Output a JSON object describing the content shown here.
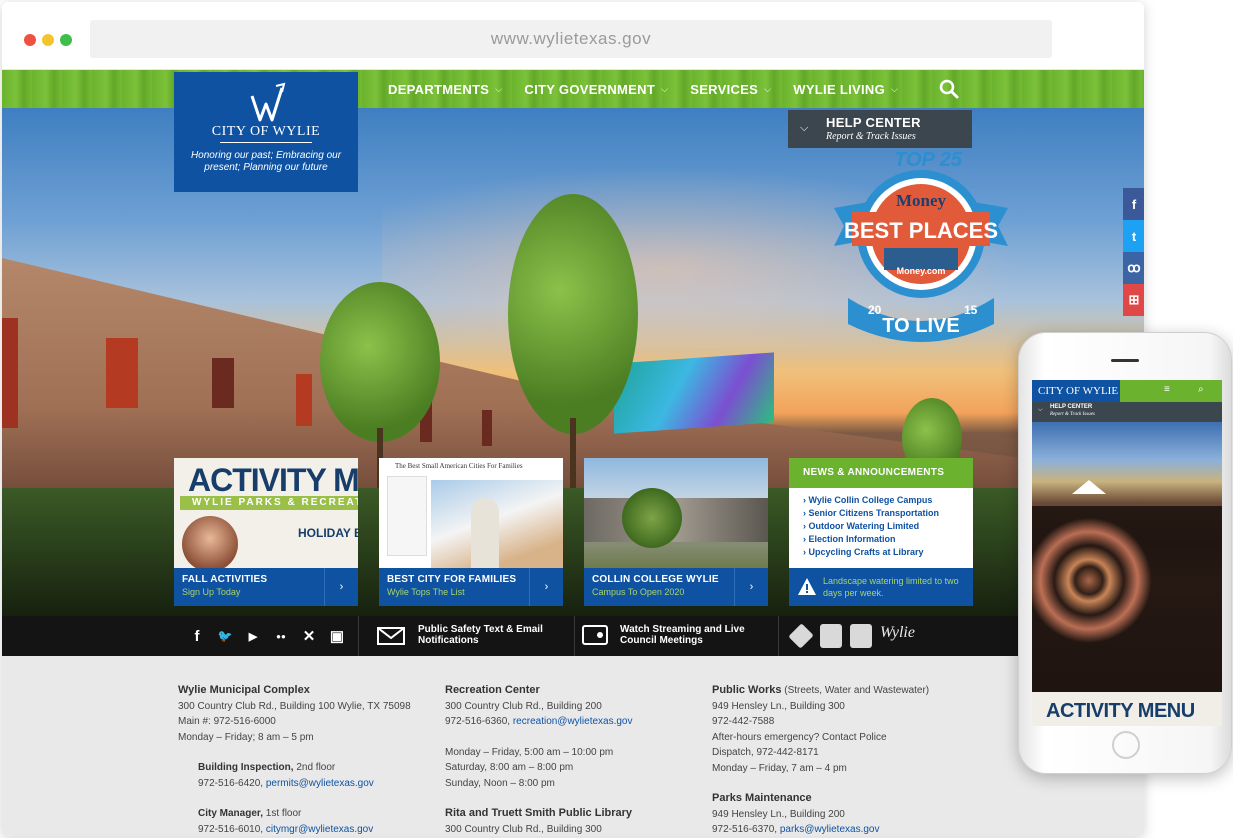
{
  "browser": {
    "url": "www.wylietexas.gov"
  },
  "nav": {
    "items": [
      {
        "label": "DEPARTMENTS"
      },
      {
        "label": "CITY GOVERNMENT"
      },
      {
        "label": "SERVICES"
      },
      {
        "label": "WYLIE LIVING"
      }
    ]
  },
  "logo": {
    "name": "CITY OF WYLIE",
    "tagline": "Honoring our past; Embracing our present; Planning our future"
  },
  "help_center": {
    "title": "HELP CENTER",
    "subtitle": "Report & Track Issues"
  },
  "badge": {
    "top": "TOP 25",
    "brand": "Money",
    "main": "BEST PLACES",
    "sub": "Money.com",
    "year_left": "20",
    "year_right": "15",
    "bottom": "TO LIVE"
  },
  "social_strip": [
    {
      "icon": "facebook-icon",
      "glyph": "f",
      "color": "#3b5998"
    },
    {
      "icon": "twitter-icon",
      "glyph": "t",
      "color": "#1da1f2"
    },
    {
      "icon": "nextdoor-icon",
      "glyph": "ꝏ",
      "color": "#3a64a4"
    },
    {
      "icon": "gift-icon",
      "glyph": "⊞",
      "color": "#e04848"
    }
  ],
  "cards": [
    {
      "title": "FALL ACTIVITIES",
      "subtitle": "Sign Up Today",
      "image_text": {
        "big": "ACTIVITY MEN",
        "band": "WYLIE PARKS & RECREATI",
        "side": "HOLIDAY BR"
      }
    },
    {
      "title": "BEST CITY FOR FAMILIES",
      "subtitle": "Wylie Tops The List",
      "image_text": {
        "header": "The Best Small American Cities For Families"
      }
    },
    {
      "title": "COLLIN COLLEGE WYLIE",
      "subtitle": "Campus To Open 2020"
    }
  ],
  "news": {
    "header": "NEWS & ANNOUNCEMENTS",
    "items": [
      "› Wylie Collin College Campus",
      "› Senior Citizens Transportation",
      "› Outdoor Watering Limited",
      "› Election Information",
      "› Upcycling Crafts at Library"
    ],
    "alert": "Landscape watering limited to two days per week."
  },
  "utility": {
    "social": [
      {
        "icon": "facebook-icon",
        "glyph": "f"
      },
      {
        "icon": "twitter-icon",
        "glyph": "🐦"
      },
      {
        "icon": "youtube-icon",
        "glyph": "▶"
      },
      {
        "icon": "flickr-icon",
        "glyph": "●●"
      },
      {
        "icon": "x-icon",
        "glyph": "✕"
      },
      {
        "icon": "calendar-icon",
        "glyph": "▣"
      }
    ],
    "notify_label": "Public Safety Text & Email Notifications",
    "stream_label": "Watch Streaming and Live Council Meetings",
    "partner_script": "Wylie"
  },
  "footer": {
    "municipal": {
      "title": "Wylie Municipal Complex",
      "lines": [
        "300 Country Club Rd., Building 100 Wylie, TX 75098",
        "Main #: 972-516-6000",
        "Monday – Friday; 8 am – 5 pm"
      ],
      "building_title": "Building Inspection,",
      "building_floor": " 2nd floor",
      "building_phone": "972-516-6420, ",
      "building_email": "permits@wylietexas.gov",
      "manager_title": "City Manager,",
      "manager_floor": " 1st floor",
      "manager_phone": "972-516-6010, ",
      "manager_email": "citymgr@wylietexas.gov"
    },
    "recreation": {
      "title": "Recreation Center",
      "address": "300 Country Club Rd., Building 200",
      "phone": "972-516-6360, ",
      "email": "recreation@wylietexas.gov",
      "hours": [
        "Monday – Friday, 5:00 am – 10:00 pm",
        "Saturday, 8:00 am – 8:00 pm",
        "Sunday, Noon – 8:00 pm"
      ],
      "library_title": "Rita and Truett Smith Public Library",
      "library_address": "300 Country Club Rd., Building 300"
    },
    "publicworks": {
      "title": "Public Works",
      "note": "(Streets, Water and Wastewater)",
      "lines": [
        "949 Hensley Ln., Building 300",
        "972-442-7588",
        "After-hours emergency? Contact Police",
        "Dispatch, 972-442-8171",
        "Monday – Friday, 7 am – 4 pm"
      ],
      "parks_title": "Parks Maintenance",
      "parks_address": "949 Hensley Ln., Building 200",
      "parks_phone": "972-516-6370, ",
      "parks_email": "parks@wylietexas.gov"
    }
  },
  "phone": {
    "logo": "CITY OF WYLIE",
    "menu_glyph": "≡",
    "search_glyph": "⌕",
    "help_title": "HELP CENTER",
    "help_sub": "Report & Track Issues",
    "activity": "ACTIVITY MENU"
  },
  "colors": {
    "blue": "#0f52a2",
    "green": "#6bb32e",
    "dark": "#141414",
    "footer_bg": "#e9e9e9"
  }
}
